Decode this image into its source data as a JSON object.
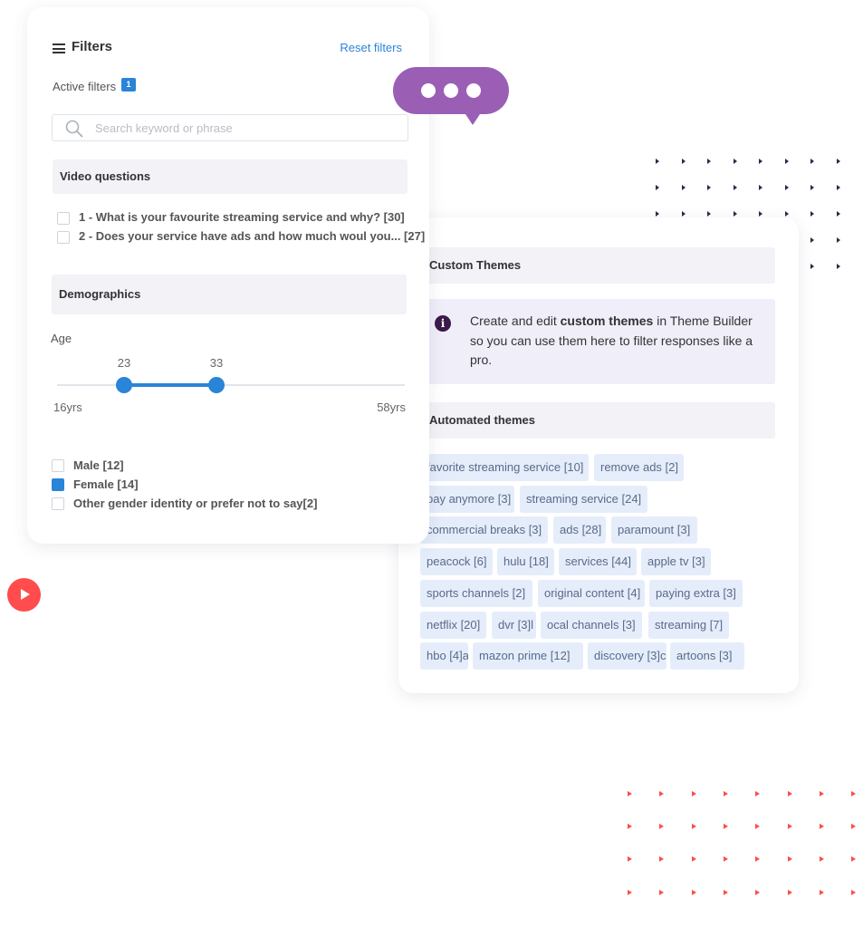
{
  "filters": {
    "title": "Filters",
    "reset_label": "Reset filters",
    "active_label": "Active filters",
    "active_count": "1",
    "search": {
      "placeholder": "Search keyword or phrase",
      "value": ""
    },
    "video_questions": {
      "heading": "Video questions",
      "items": [
        {
          "label": "1 - What is your favourite streaming service and why? [30]",
          "checked": false
        },
        {
          "label": "2 - Does your service have ads and how much woul you... [27]",
          "checked": false
        }
      ]
    },
    "demographics": {
      "heading": "Demographics",
      "age_label": "Age",
      "age_low": "23",
      "age_high": "33",
      "range_min": "16yrs",
      "range_max": "58yrs",
      "gender": [
        {
          "label": "Male [12]",
          "checked": false
        },
        {
          "label": "Female [14]",
          "checked": true
        },
        {
          "label": "Other gender identity or prefer not to say[2]",
          "checked": false
        }
      ]
    }
  },
  "themes": {
    "custom_heading": "Custom Themes",
    "info_icon": "info-icon",
    "info_pre": "Create and edit ",
    "info_bold": "custom themes",
    "info_post": " in Theme Builder so you can use them here to filter responses like a pro.",
    "automated_heading": "Automated themes",
    "tags": [
      "favorite streaming service [10]",
      "remove ads [2]",
      "pay anymore [3]",
      "streaming service [24]",
      "commercial breaks [3]",
      "ads [28]",
      "paramount [3]",
      "peacock [6]",
      "hulu [18]",
      "services [44]",
      "apple tv [3]",
      "sports channels [2]",
      "original content [4]",
      "paying extra [3]",
      "netflix [20]",
      "dvr [3]l",
      "ocal channels [3]",
      "streaming [7]",
      "hbo [4]a",
      "mazon prime [12]",
      "discovery [3]c",
      "artoons [3]"
    ]
  },
  "colors": {
    "accent": "#2a84d8",
    "bubble": "#9a5fb5",
    "play": "#ff4c4c",
    "tag_bg": "#e5edfb"
  }
}
